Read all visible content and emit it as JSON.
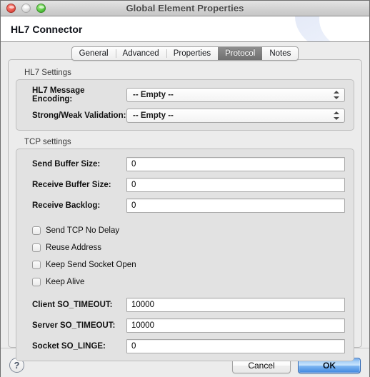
{
  "window": {
    "title": "Global Element Properties",
    "traffic_lights": [
      {
        "name": "close",
        "enabled": true
      },
      {
        "name": "minimize",
        "enabled": false
      },
      {
        "name": "zoom",
        "enabled": true
      }
    ]
  },
  "header": {
    "title": "HL7 Connector"
  },
  "tabs": [
    {
      "label": "General",
      "selected": false
    },
    {
      "label": "Advanced",
      "selected": false
    },
    {
      "label": "Properties",
      "selected": false
    },
    {
      "label": "Protocol",
      "selected": true
    },
    {
      "label": "Notes",
      "selected": false
    }
  ],
  "groups": {
    "hl7": {
      "title": "HL7 Settings",
      "fields": [
        {
          "label": "HL7 Message Encoding:",
          "value": "-- Empty --",
          "type": "combo"
        },
        {
          "label": "Strong/Weak Validation:",
          "value": "-- Empty --",
          "type": "combo"
        }
      ]
    },
    "tcp": {
      "title": "TCP settings",
      "fields_top": [
        {
          "label": "Send Buffer Size:",
          "value": "0"
        },
        {
          "label": "Receive Buffer Size:",
          "value": "0"
        },
        {
          "label": "Receive Backlog:",
          "value": "0"
        }
      ],
      "checkboxes": [
        {
          "label": "Send TCP No Delay",
          "checked": false
        },
        {
          "label": "Reuse Address",
          "checked": false
        },
        {
          "label": "Keep Send Socket Open",
          "checked": false
        },
        {
          "label": "Keep Alive",
          "checked": false
        }
      ],
      "fields_bottom": [
        {
          "label": "Client SO_TIMEOUT:",
          "value": "10000"
        },
        {
          "label": "Server SO_TIMEOUT:",
          "value": "10000"
        },
        {
          "label": "Socket SO_LINGE:",
          "value": "0"
        }
      ]
    }
  },
  "footer": {
    "help_glyph": "?",
    "cancel_label": "Cancel",
    "ok_label": "OK"
  },
  "colors": {
    "accent_blue": "#3f87e0",
    "tab_selected": "#7f7f7f",
    "window_bg": "#ececec",
    "group_bg": "#e2e2e2"
  }
}
